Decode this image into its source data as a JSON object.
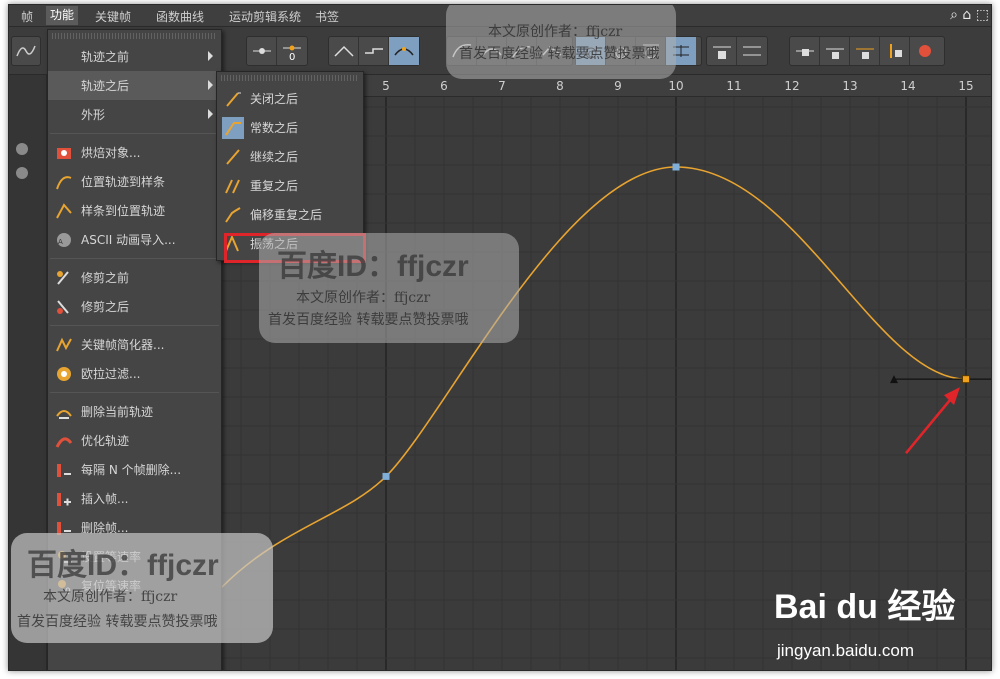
{
  "menubar": {
    "items": [
      "帧",
      "功能",
      "关键帧",
      "函数曲线",
      "运动剪辑系统",
      "书签"
    ],
    "active_index": 1
  },
  "ruler": {
    "labels": [
      "5",
      "6",
      "7",
      "8",
      "9",
      "10",
      "11",
      "12",
      "13",
      "14",
      "15"
    ]
  },
  "main_menu": {
    "items": [
      {
        "label": "轨迹之前",
        "icon": "none",
        "submenu": true
      },
      {
        "label": "轨迹之后",
        "icon": "none",
        "submenu": true,
        "highlighted": true
      },
      {
        "label": "外形",
        "icon": "none",
        "submenu": true
      },
      {
        "label": "烘焙对象...",
        "icon": "bake-icon"
      },
      {
        "label": "位置轨迹到样条",
        "icon": "track-to-spline-icon"
      },
      {
        "label": "样条到位置轨迹",
        "icon": "spline-to-track-icon"
      },
      {
        "label": "ASCII 动画导入...",
        "icon": "ascii-import-icon"
      },
      {
        "label": "修剪之前",
        "icon": "trim-before-icon"
      },
      {
        "label": "修剪之后",
        "icon": "trim-after-icon"
      },
      {
        "label": "关键帧简化器...",
        "icon": "key-reducer-icon"
      },
      {
        "label": "欧拉过滤...",
        "icon": "euler-filter-icon"
      },
      {
        "label": "删除当前轨迹",
        "icon": "delete-track-icon"
      },
      {
        "label": "优化轨迹",
        "icon": "optimize-track-icon"
      },
      {
        "label": "每隔 N 个帧删除...",
        "icon": "delete-every-n-icon"
      },
      {
        "label": "插入帧...",
        "icon": "insert-frames-icon"
      },
      {
        "label": "删除帧...",
        "icon": "delete-frames-icon"
      },
      {
        "label": "设置等速率",
        "icon": "set-speed-icon"
      },
      {
        "label": "复位等速率",
        "icon": "reset-speed-icon"
      }
    ]
  },
  "sub_menu": {
    "items": [
      {
        "label": "关闭之后",
        "icon": "off-after-icon"
      },
      {
        "label": "常数之后",
        "icon": "constant-after-icon",
        "selected": true
      },
      {
        "label": "继续之后",
        "icon": "continue-after-icon"
      },
      {
        "label": "重复之后",
        "icon": "repeat-after-icon"
      },
      {
        "label": "偏移重复之后",
        "icon": "offset-repeat-after-icon"
      },
      {
        "label": "振荡之后",
        "icon": "oscillate-after-icon",
        "boxed": true
      }
    ]
  },
  "toolbar": {
    "icons": [
      "key-zero-icon",
      "peak-key-icon",
      "step-key-icon",
      "ease-key-icon",
      "spline-auto-icon",
      "spline-linear-icon",
      "spline-break-icon",
      "zero-angle-icon",
      "zero-length-icon",
      "lock-time-icon",
      "lock-value-icon",
      "lock-angle-icon",
      "lock-length-icon",
      "tangent-lock-icon"
    ]
  },
  "curve": {
    "keys": [
      {
        "frame": 5,
        "value": 0.3,
        "color": "#7faed8"
      },
      {
        "frame": 10,
        "value": 1.0,
        "color": "#7faed8"
      },
      {
        "frame": 15,
        "value": 0.52,
        "color": "#f0a21c",
        "selected": true
      }
    ],
    "curve_color": "#e8a430"
  },
  "watermark": {
    "id_text": "百度ID：ffjczr",
    "author_text": "本文原创作者：ffjczr",
    "note_text": "首发百度经验 转载要点赞投票哦",
    "logo_text": "Bai du 经验",
    "url_text": "jingyan.baidu.com"
  }
}
